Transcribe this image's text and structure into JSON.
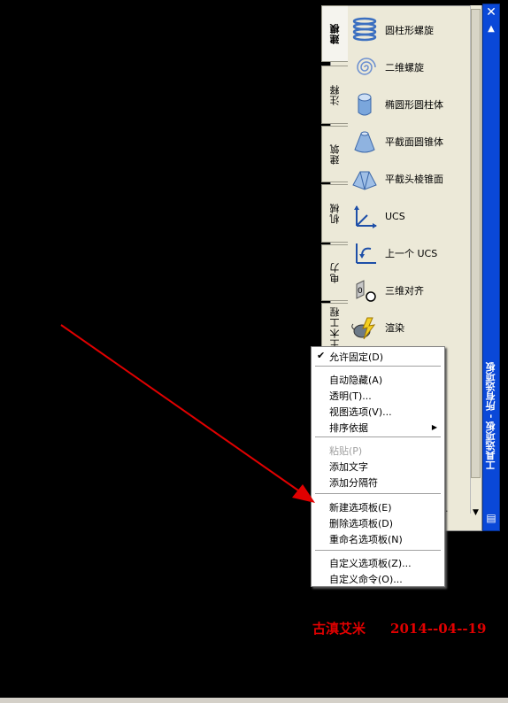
{
  "palette": {
    "title": "工具选项板 - 所有选项板",
    "tabs": [
      "建模",
      "注释",
      "建筑",
      "机械",
      "电力",
      "土木工程"
    ],
    "tools": [
      {
        "label": "圆柱形螺旋",
        "icon": "helix-icon"
      },
      {
        "label": "二维螺旋",
        "icon": "spiral-icon"
      },
      {
        "label": "椭圆形圆柱体",
        "icon": "elliptical-cylinder-icon"
      },
      {
        "label": "平截面圆锥体",
        "icon": "frustum-cone-icon"
      },
      {
        "label": "平截头棱锥面",
        "icon": "frustum-pyramid-icon"
      },
      {
        "label": "UCS",
        "icon": "ucs-icon"
      },
      {
        "label": "上一个 UCS",
        "icon": "ucs-previous-icon"
      },
      {
        "label": "三维对齐",
        "icon": "3d-align-icon"
      },
      {
        "label": "渲染",
        "icon": "render-teapot-icon"
      }
    ],
    "partial_text": "."
  },
  "context_menu": {
    "items": [
      {
        "label": "允许固定(D)",
        "checked": true
      },
      {
        "label": "自动隐藏(A)"
      },
      {
        "label": "透明(T)..."
      },
      {
        "label": "视图选项(V)..."
      },
      {
        "label": "排序依据",
        "submenu": true
      },
      {
        "label": "粘贴(P)",
        "disabled": true
      },
      {
        "label": "添加文字"
      },
      {
        "label": "添加分隔符"
      },
      {
        "label": "新建选项板(E)"
      },
      {
        "label": "删除选项板(D)"
      },
      {
        "label": "重命名选项板(N)"
      },
      {
        "label": "自定义选项板(Z)..."
      },
      {
        "label": "自定义命令(O)..."
      }
    ]
  },
  "watermark": {
    "author": "古滇艾米",
    "date": "2014--04--19"
  },
  "colors": {
    "titlebar": "#0a48d8",
    "arrow": "#e00000",
    "watermark": "#e00000"
  }
}
